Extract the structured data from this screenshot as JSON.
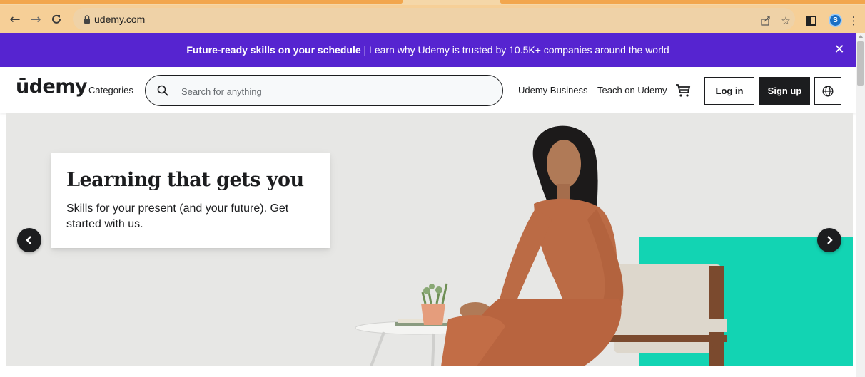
{
  "browser": {
    "url": "udemy.com",
    "profile_initial": "S",
    "icons": [
      "back-icon",
      "forward-icon",
      "reload-icon",
      "lock-icon",
      "share-icon",
      "star-icon",
      "side-panel-icon",
      "menu-icon"
    ]
  },
  "banner": {
    "bold_text": "Future-ready skills on your schedule",
    "text": " | Learn why Udemy is trusted by 10.5K+ companies around the world",
    "bg_color": "#5624d0"
  },
  "header": {
    "logo": "ūdemy",
    "categories": "Categories",
    "search": {
      "placeholder": "Search for anything",
      "value": ""
    },
    "links": {
      "business": "Udemy Business",
      "teach": "Teach on Udemy"
    },
    "login": "Log in",
    "signup": "Sign up",
    "accent_color": "#a435f0"
  },
  "hero": {
    "title": "Learning that gets you",
    "subtitle": "Skills for your present (and your future). Get started with us.",
    "accent_color": "#12d4b3"
  }
}
